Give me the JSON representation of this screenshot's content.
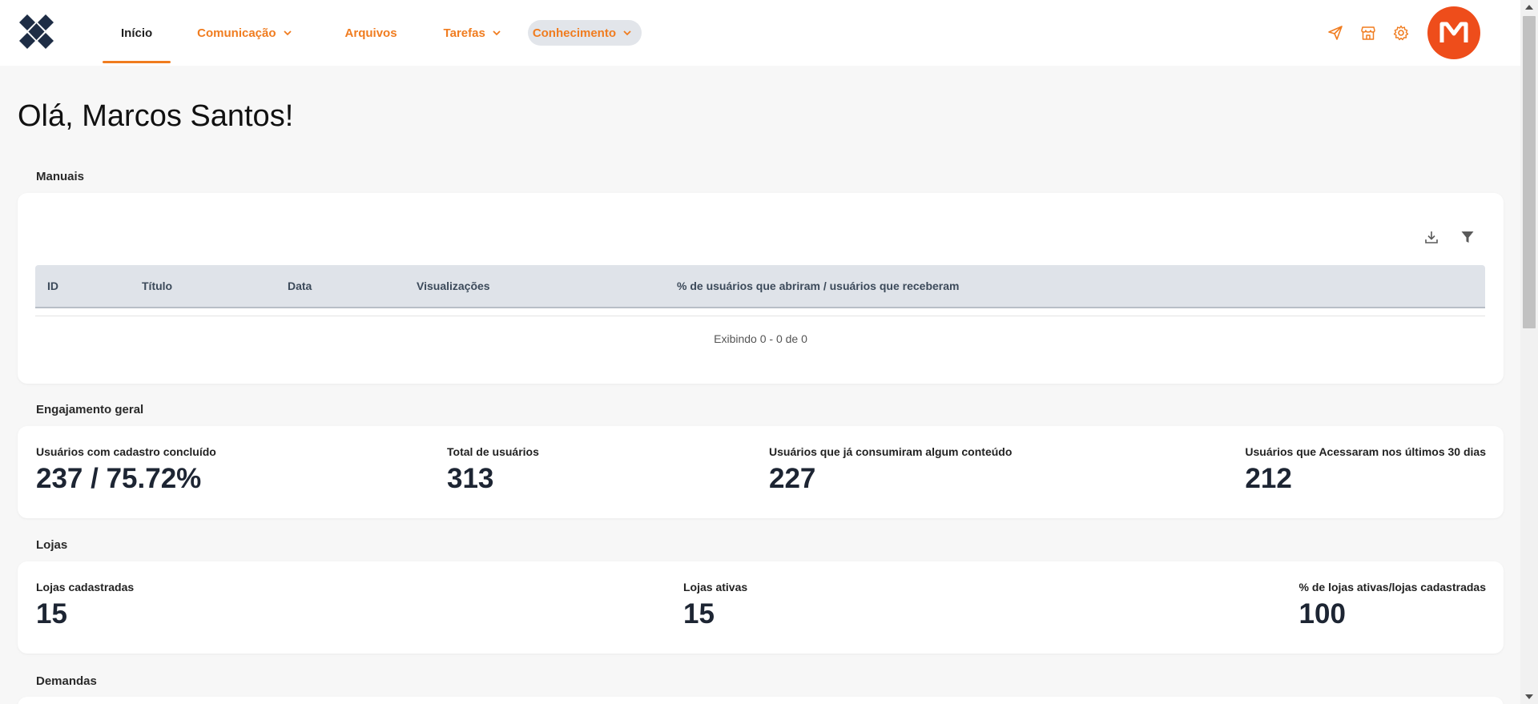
{
  "nav": {
    "items": [
      {
        "label": "Início",
        "active": true
      },
      {
        "label": "Comunicação",
        "dropdown": true
      },
      {
        "label": "Arquivos"
      },
      {
        "label": "Tarefas",
        "dropdown": true
      },
      {
        "label": "Conhecimento",
        "dropdown": true,
        "highlighted": true
      }
    ],
    "right_icons": [
      "send-icon",
      "store-icon",
      "gear-icon"
    ],
    "avatar_letter": "M",
    "accent": "#f07c1f",
    "avatar_color": "#ee4d1b"
  },
  "greeting": "Olá, Marcos Santos!",
  "manuais": {
    "title": "Manuais",
    "tools": [
      "download-icon",
      "filter-icon"
    ],
    "columns": [
      "ID",
      "Título",
      "Data",
      "Visualizações",
      "% de usuários que abriram / usuários que receberam"
    ],
    "rows": [],
    "footer": "Exibindo 0 - 0 de 0"
  },
  "engajamento": {
    "title": "Engajamento geral",
    "stats": [
      {
        "label": "Usuários com cadastro concluído",
        "value": "237 / 75.72%"
      },
      {
        "label": "Total de usuários",
        "value": "313"
      },
      {
        "label": "Usuários que já consumiram algum conteúdo",
        "value": "227"
      },
      {
        "label": "Usuários que Acessaram nos últimos 30 dias",
        "value": "212"
      }
    ]
  },
  "lojas": {
    "title": "Lojas",
    "stats": [
      {
        "label": "Lojas cadastradas",
        "value": "15"
      },
      {
        "label": "Lojas ativas",
        "value": "15"
      },
      {
        "label": "% de lojas ativas/lojas cadastradas",
        "value": "100"
      }
    ]
  },
  "demandas": {
    "title": "Demandas"
  }
}
